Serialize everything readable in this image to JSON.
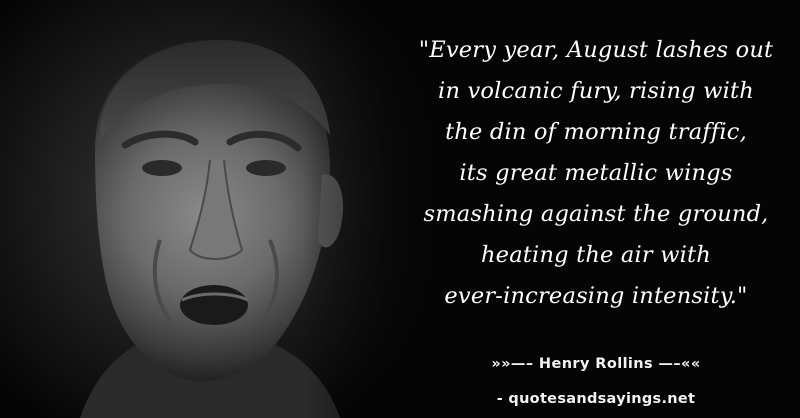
{
  "quote": {
    "lines": [
      "\"Every year, August lashes out",
      "in volcanic fury, rising with",
      "the din of morning traffic,",
      "its great metallic wings",
      "smashing against the ground,",
      "heating the air with",
      "ever-increasing intensity.\""
    ]
  },
  "attribution": "»»—– Henry Rollins —–««",
  "source": "- quotesandsayings.net",
  "colors": {
    "background": "#050505",
    "text": "#ffffff"
  }
}
